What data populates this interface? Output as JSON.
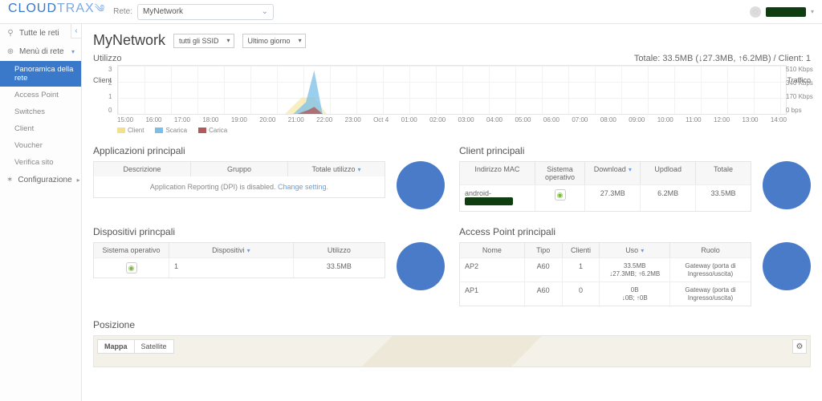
{
  "brand": {
    "part1": "CLOUD",
    "part2": "TRAX"
  },
  "header": {
    "net_label": "Rete:",
    "net_value": "MyNetwork"
  },
  "sidebar": {
    "all_nets": "Tutte le reti",
    "menu_rete": "Menù di rete",
    "items": [
      "Panoramica della rete",
      "Access Point",
      "Switches",
      "Client",
      "Voucher",
      "Verifica sito"
    ],
    "config": "Configurazione"
  },
  "page": {
    "title": "MyNetwork",
    "ssid_select": "tutti gli SSID",
    "time_select": "Ultimo giorno"
  },
  "utilizzo": {
    "label": "Utilizzo",
    "totals": "Totale: 33.5MB (↓27.3MB, ↑6.2MB) / Client: 1",
    "axis_left": "Client",
    "axis_right": "Traffico",
    "legend": {
      "client": "Client",
      "scarica": "Scarica",
      "carica": "Carica"
    },
    "colors": {
      "client": "#f3e08a",
      "scarica": "#7bbfe8",
      "carica": "#b05a5a"
    }
  },
  "chart_data": {
    "type": "area",
    "x": [
      "15:00",
      "16:00",
      "17:00",
      "18:00",
      "19:00",
      "20:00",
      "21:00",
      "22:00",
      "23:00",
      "Oct 4",
      "01:00",
      "02:00",
      "03:00",
      "04:00",
      "05:00",
      "06:00",
      "07:00",
      "08:00",
      "09:00",
      "10:00",
      "11:00",
      "12:00",
      "13:00",
      "14:00"
    ],
    "series": [
      {
        "name": "Client",
        "axis": "left",
        "unit": "clients",
        "values": [
          0,
          0,
          0,
          0,
          0,
          0,
          1,
          1,
          0,
          0,
          0,
          0,
          0,
          0,
          0,
          0,
          0,
          0,
          0,
          0,
          0,
          0,
          0,
          0
        ]
      },
      {
        "name": "Scarica",
        "axis": "right",
        "unit": "Kbps",
        "values": [
          0,
          0,
          0,
          0,
          0,
          0,
          120,
          460,
          0,
          0,
          0,
          0,
          0,
          0,
          0,
          0,
          0,
          0,
          0,
          0,
          0,
          0,
          0,
          0
        ]
      },
      {
        "name": "Carica",
        "axis": "right",
        "unit": "Kbps",
        "values": [
          0,
          0,
          0,
          0,
          0,
          0,
          40,
          70,
          0,
          0,
          0,
          0,
          0,
          0,
          0,
          0,
          0,
          0,
          0,
          0,
          0,
          0,
          0,
          0
        ]
      }
    ],
    "y_left": {
      "label": "Client",
      "ticks": [
        3,
        2,
        1,
        0
      ]
    },
    "y_right": {
      "label": "Traffico",
      "ticks": [
        "510 Kbps",
        "340 Kbps",
        "170 Kbps",
        "0 bps"
      ]
    }
  },
  "apps": {
    "title": "Applicazioni principali",
    "cols": [
      "Descrizione",
      "Gruppo",
      "Totale utilizzo"
    ],
    "dpi_msg": "Application Reporting (DPI) is disabled.",
    "dpi_link": "Change setting."
  },
  "clients": {
    "title": "Client principali",
    "cols": [
      "Indirizzo MAC",
      "Sistema operativo",
      "Download",
      "Updload",
      "Totale"
    ],
    "rows": [
      {
        "mac_prefix": "android-",
        "os": "android",
        "download": "27.3MB",
        "upload": "6.2MB",
        "total": "33.5MB"
      }
    ]
  },
  "devices": {
    "title": "Dispositivi princpali",
    "cols": [
      "Sistema operativo",
      "Dispositivi",
      "Utilizzo"
    ],
    "rows": [
      {
        "os": "android",
        "count": "1",
        "usage": "33.5MB"
      }
    ]
  },
  "aps": {
    "title": "Access Point principali",
    "cols": [
      "Nome",
      "Tipo",
      "Clienti",
      "Uso",
      "Ruolo"
    ],
    "rows": [
      {
        "name": "AP2",
        "type": "A60",
        "clients": "1",
        "usage": "33.5MB",
        "usage2": "↓27.3MB; ↑6.2MB",
        "role": "Gateway (porta di Ingresso/uscita)"
      },
      {
        "name": "AP1",
        "type": "A60",
        "clients": "0",
        "usage": "0B",
        "usage2": "↓0B; ↑0B",
        "role": "Gateway (porta di Ingresso/uscita)"
      }
    ]
  },
  "map": {
    "title": "Posizione",
    "tab_map": "Mappa",
    "tab_sat": "Satellite"
  }
}
